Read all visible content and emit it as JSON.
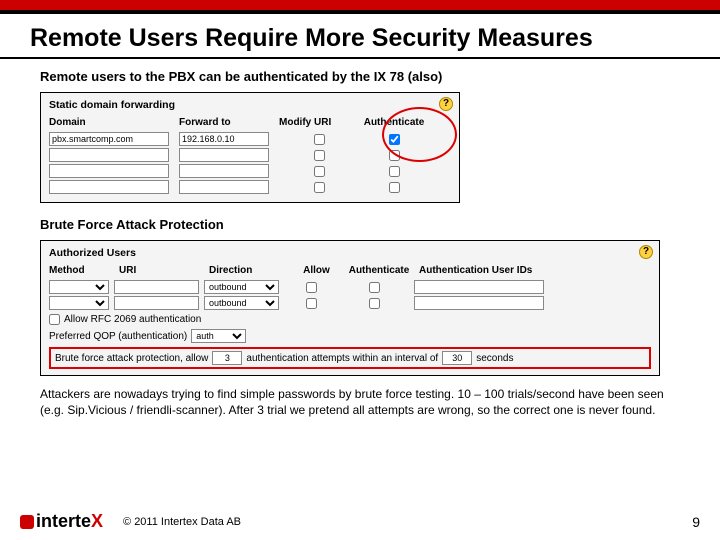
{
  "title": "Remote Users Require More Security Measures",
  "sub1": "Remote users to the PBX can be authenticated by the IX 78 (also)",
  "sdf": {
    "title": "Static domain forwarding",
    "headers": [
      "Domain",
      "Forward to",
      "Modify URI",
      "Authenticate"
    ],
    "rows": [
      {
        "domain": "pbx.smartcomp.com",
        "fwd": "192.168.0.10",
        "auth": true
      },
      {
        "domain": "",
        "fwd": "",
        "auth": false
      },
      {
        "domain": "",
        "fwd": "",
        "auth": false
      },
      {
        "domain": "",
        "fwd": "",
        "auth": false
      }
    ]
  },
  "sub2": "Brute Force Attack Protection",
  "au": {
    "title": "Authorized Users",
    "headers": [
      "Method",
      "URI",
      "Direction",
      "Allow",
      "Authenticate",
      "Authentication User IDs"
    ],
    "rows": [
      {
        "direction": "outbound"
      },
      {
        "direction": "outbound"
      }
    ],
    "rfc": "Allow RFC 2069 authentication",
    "qop": "Preferred QOP (authentication)",
    "qopval": "auth",
    "bf1": "Brute force attack protection, allow",
    "bfval1": "3",
    "bf2": "authentication attempts within an interval of",
    "bfval2": "30",
    "bf3": "seconds"
  },
  "body": "Attackers are nowadays trying to find simple passwords by brute force testing. 10 – 100 trials/second have been seen (e.g. Sip.Vicious / friendli-scanner). After 3 trial we pretend all attempts are wrong, so the correct one is never found.",
  "logo": {
    "a": "interte",
    "b": "X"
  },
  "copy": "© 2011 Intertex Data AB",
  "pagenum": "9"
}
